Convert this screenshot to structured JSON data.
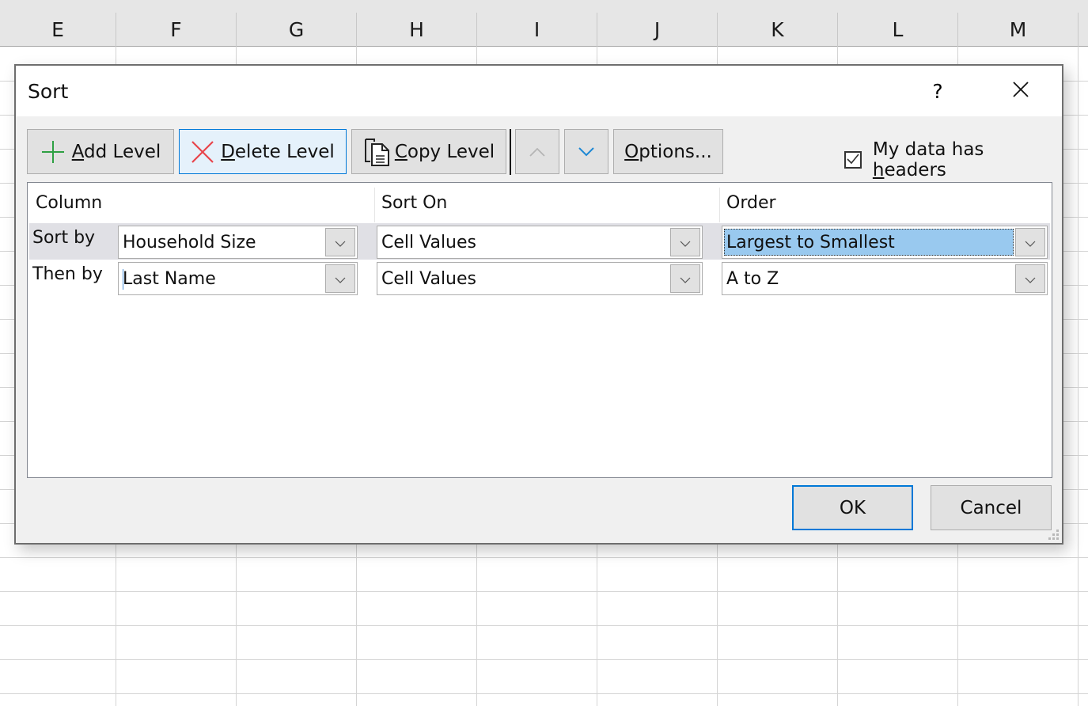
{
  "spreadsheet": {
    "columns": [
      "E",
      "F",
      "G",
      "H",
      "I",
      "J",
      "K",
      "L",
      "M"
    ]
  },
  "dialog": {
    "title": "Sort",
    "help_label": "?",
    "close_icon": "close-icon",
    "toolbar": {
      "add_level": {
        "label_u": "A",
        "label_rest": "dd Level",
        "icon": "plus-icon",
        "color": "#2ea043"
      },
      "delete_level": {
        "label_u": "D",
        "label_rest": "elete Level",
        "icon": "x-icon",
        "color": "#e8454c"
      },
      "copy_level": {
        "label_u": "C",
        "label_rest": "opy Level",
        "icon": "copy-icon"
      },
      "move_up": {
        "icon": "chevron-up-icon",
        "enabled": false
      },
      "move_down": {
        "icon": "chevron-down-icon",
        "enabled": true,
        "color": "#1e88d4"
      },
      "options": {
        "label_u": "O",
        "label_rest": "ptions..."
      }
    },
    "headers_checkbox": {
      "checked": true,
      "label_pre": "My data has ",
      "label_u": "h",
      "label_rest": "eaders"
    },
    "columns_header": {
      "column": "Column",
      "sort_on": "Sort On",
      "order": "Order"
    },
    "levels": [
      {
        "label": "Sort by",
        "column": "Household Size",
        "sort_on": "Cell Values",
        "order": "Largest to Smallest",
        "selected": true
      },
      {
        "label": "Then by",
        "column": "Last Name",
        "sort_on": "Cell Values",
        "order": "A to Z",
        "selected": false
      }
    ],
    "ok_label": "OK",
    "cancel_label": "Cancel",
    "accent_color": "#0078d7",
    "highlight_color": "#99c9ef"
  }
}
